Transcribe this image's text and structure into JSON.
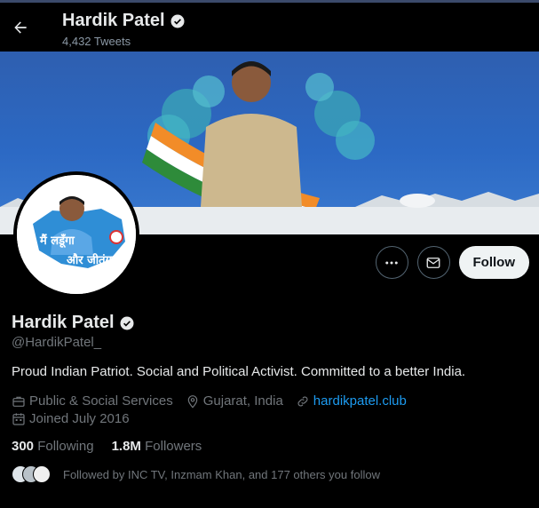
{
  "header": {
    "name": "Hardik Patel",
    "tweet_count": "4,432 Tweets"
  },
  "banner": {
    "description": "Campaign banner with a man in front of a map of Gujarat painted in tricolour"
  },
  "avatar": {
    "slogan_line1": "मैं लडूँगा",
    "slogan_line2": "और जीतूंगा"
  },
  "actions": {
    "follow_label": "Follow"
  },
  "profile": {
    "name": "Hardik Patel",
    "handle": "@HardikPatel_",
    "bio": "Proud Indian Patriot. Social and Political Activist. Committed to a better India.",
    "category": "Public & Social Services",
    "location": "Gujarat, India",
    "website": "hardikpatel.club",
    "joined": "Joined July 2016"
  },
  "stats": {
    "following_count": "300",
    "following_label": "Following",
    "followers_count": "1.8M",
    "followers_label": "Followers"
  },
  "followed_by": {
    "text": "Followed by INC TV, Inzmam Khan, and 177 others you follow"
  },
  "colors": {
    "background": "#000000",
    "accent_link": "#1d9bf0",
    "secondary_text": "#71767b",
    "verified_badge": "#e7e9ea"
  }
}
